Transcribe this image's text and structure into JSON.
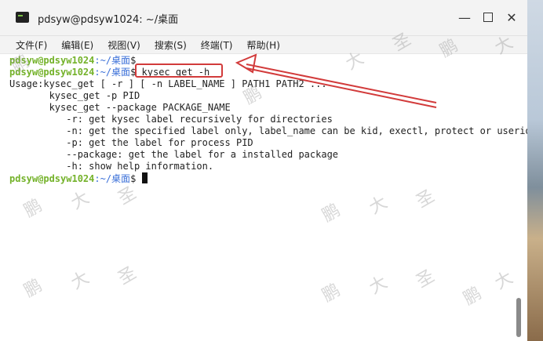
{
  "window": {
    "title": "pdsyw@pdsyw1024: ~/桌面"
  },
  "menu": [
    {
      "label": "文件(F)"
    },
    {
      "label": "编辑(E)"
    },
    {
      "label": "视图(V)"
    },
    {
      "label": "搜索(S)"
    },
    {
      "label": "终端(T)"
    },
    {
      "label": "帮助(H)"
    }
  ],
  "terminal": {
    "user": "pdsyw@pdsyw1024",
    "path": ":~/桌面",
    "prompt_symbol": "$",
    "command": "kysec_get -h",
    "output": [
      "Usage:kysec_get [ -r ] [ -n LABEL_NAME ] PATH1 PATH2 ...",
      "       kysec_get -p PID",
      "       kysec_get --package PACKAGE_NAME",
      "          -r: get kysec label recursively for directories",
      "          -n: get the specified label only, label_name can be kid, exectl, protect or userid",
      "          -p: get the label for process PID",
      "          --package: get the label for a installed package",
      "          -h: show help information."
    ]
  },
  "watermark_text": [
    "鹏",
    "大",
    "圣"
  ],
  "colors": {
    "prompt_user": "#74b22a",
    "prompt_path": "#3a6fd8",
    "annotation": "#d23b3b"
  }
}
